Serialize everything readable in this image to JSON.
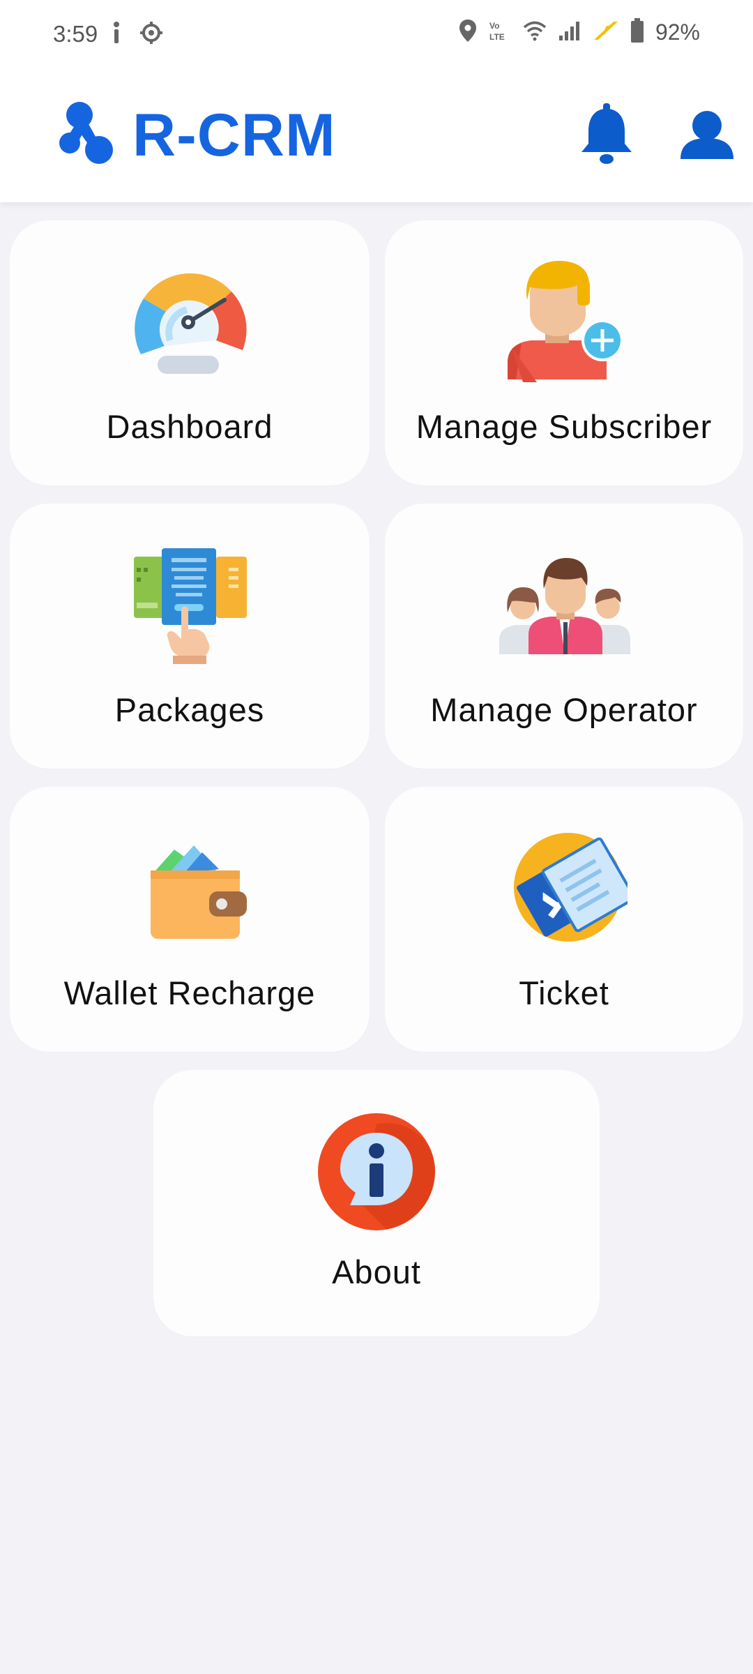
{
  "status_bar": {
    "time": "3:59",
    "battery": "92%",
    "icons": [
      "info-icon",
      "settings-icon",
      "location-icon",
      "volte-icon",
      "wifi-icon",
      "signal-icon",
      "charging-icon",
      "battery-icon"
    ]
  },
  "app_bar": {
    "title": "R-CRM",
    "brand_color": "#1565e0",
    "actions": [
      "bell-icon",
      "user-icon"
    ]
  },
  "menu": {
    "dashboard": "Dashboard",
    "manage_subscriber": "Manage Subscriber",
    "packages": "Packages",
    "manage_operator": "Manage Operator",
    "wallet_recharge": "Wallet Recharge",
    "ticket": "Ticket",
    "about": "About"
  }
}
